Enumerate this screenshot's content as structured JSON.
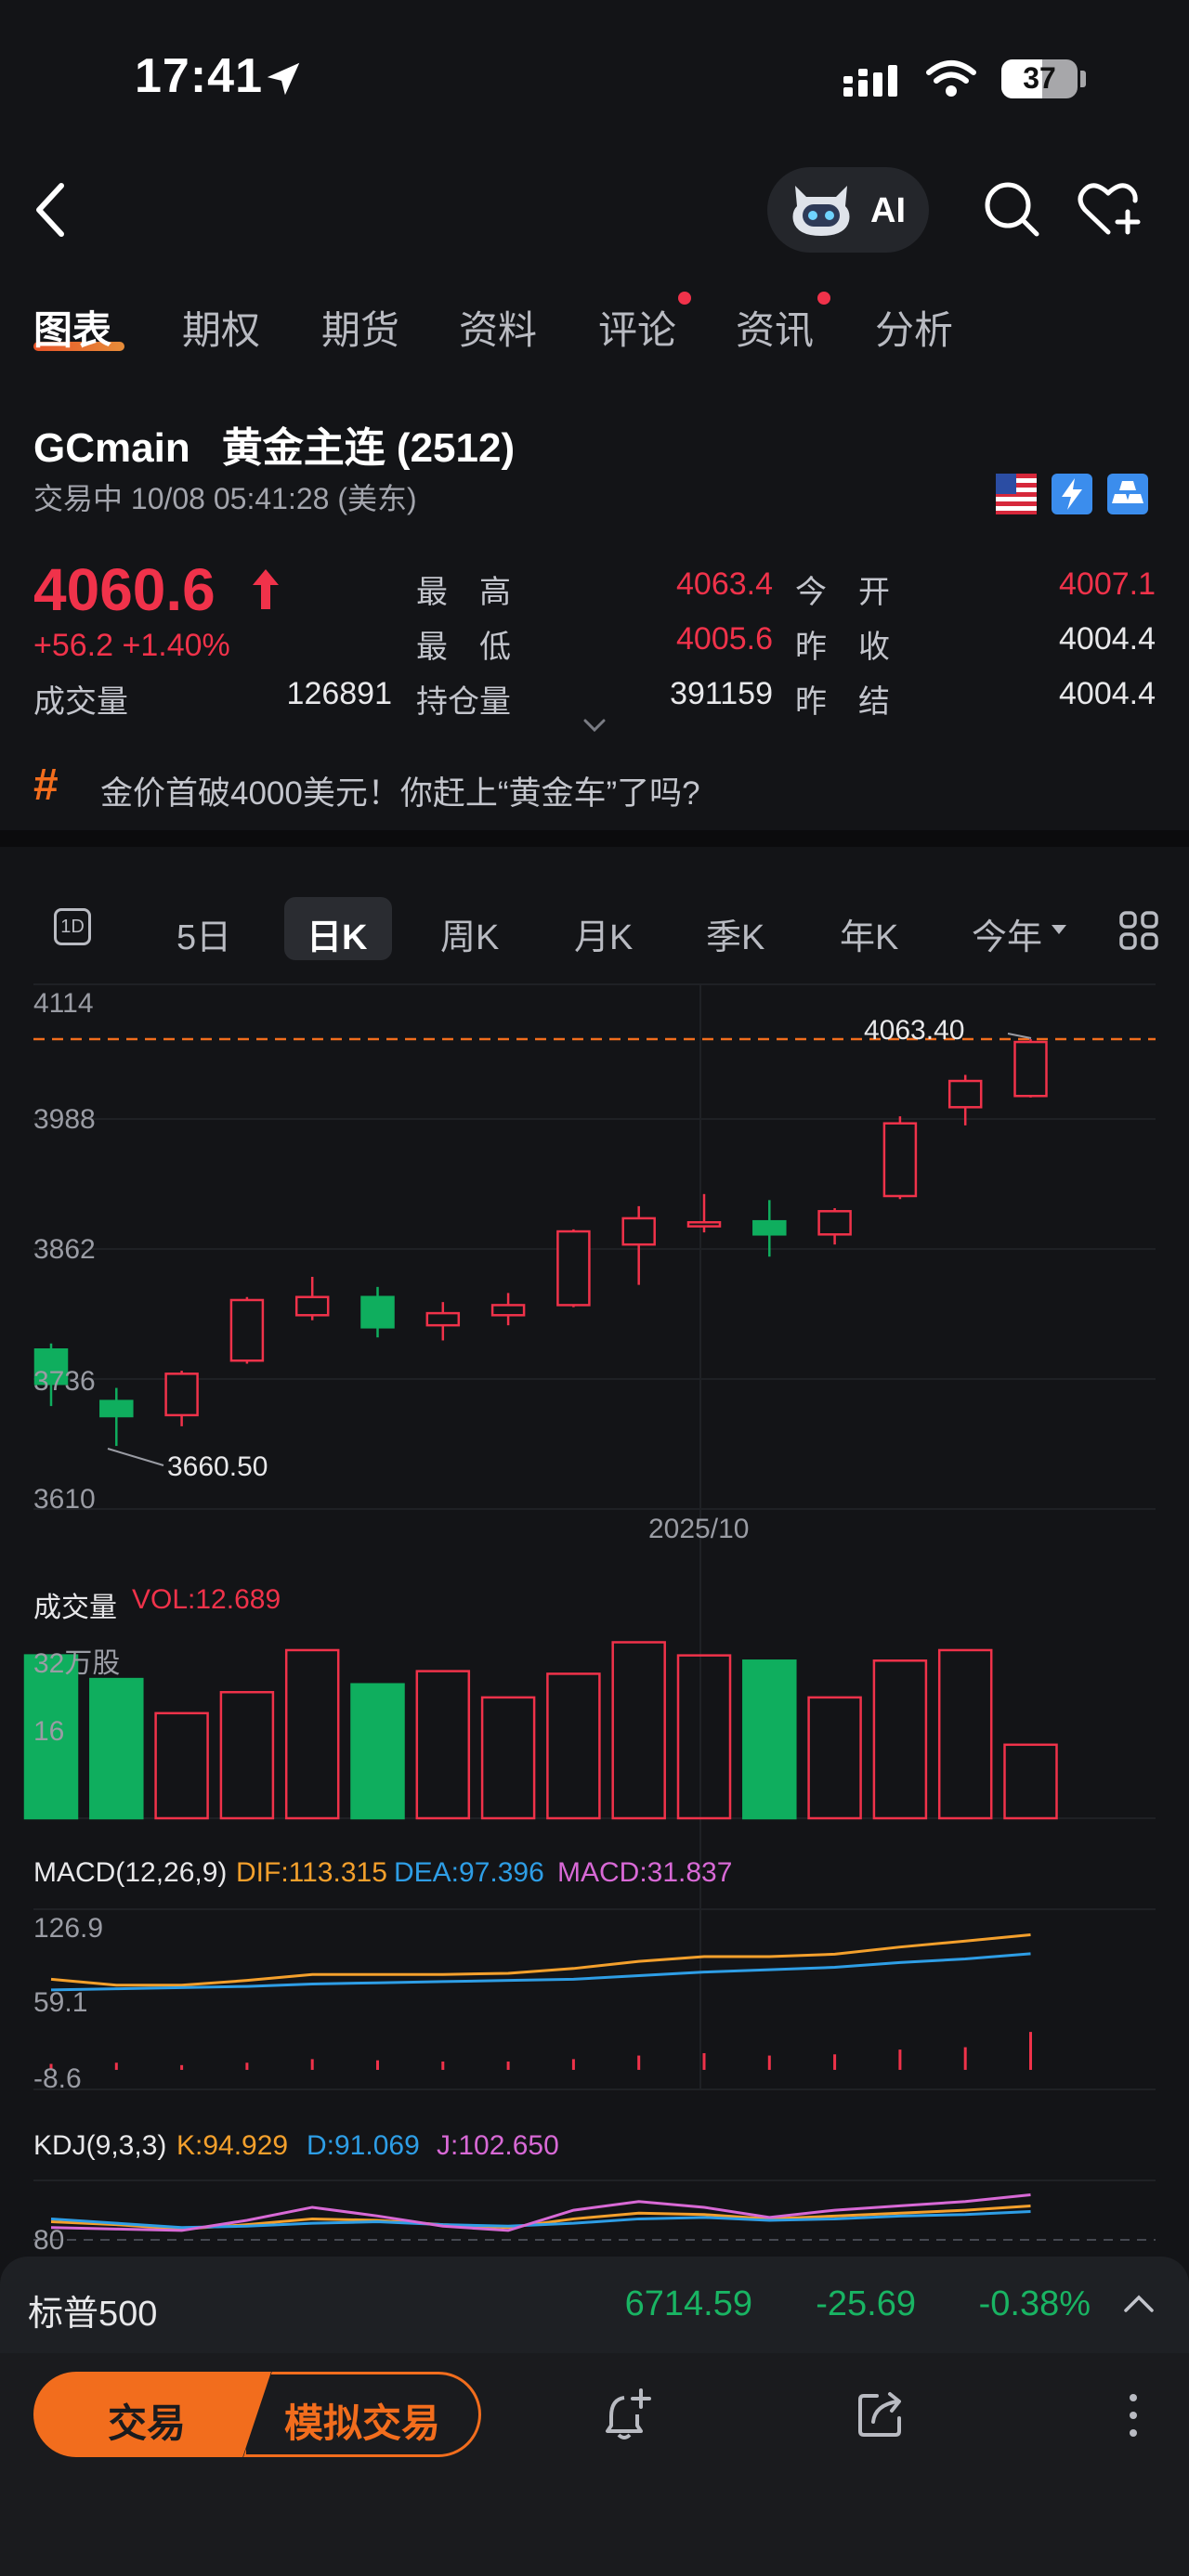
{
  "status": {
    "time": "17:41",
    "battery": "37"
  },
  "nav": {
    "ai_label": "AI"
  },
  "tabs": [
    {
      "label": "图表"
    },
    {
      "label": "期权"
    },
    {
      "label": "期货"
    },
    {
      "label": "资料"
    },
    {
      "label": "评论"
    },
    {
      "label": "资讯"
    },
    {
      "label": "分析"
    }
  ],
  "quote": {
    "symbol": "GCmain",
    "name": "黄金主连 (2512)",
    "status_line": "交易中 10/08 05:41:28 (美东)",
    "price": "4060.6",
    "change": "+56.2",
    "change_pct": "+1.40%",
    "volume_label": "成交量",
    "volume": "126891",
    "high_label": "最　高",
    "high": "4063.4",
    "low_label": "最　低",
    "low": "4005.6",
    "oi_label": "持仓量",
    "open_interest": "391159",
    "open_label": "今　开",
    "open": "4007.1",
    "prev_close_label": "昨　收",
    "prev_close": "4004.4",
    "prev_settle_label": "昨　结",
    "prev_settle": "4004.4"
  },
  "news": {
    "tag": "#",
    "headline": "金价首破4000美元！你赶上“黄金车”了吗?"
  },
  "periods": [
    {
      "label": "1D"
    },
    {
      "label": "5日"
    },
    {
      "label": "日K"
    },
    {
      "label": "周K"
    },
    {
      "label": "月K"
    },
    {
      "label": "季K"
    },
    {
      "label": "年K"
    },
    {
      "label": "今年"
    }
  ],
  "main_chart": {
    "y_ticks": [
      "4114",
      "3988",
      "3862",
      "3736",
      "3610"
    ],
    "max_label": "4063.40",
    "min_label": "3660.50",
    "date_label": "2025/10"
  },
  "volume_panel": {
    "title": "成交量",
    "vol_text": "VOL:12.689",
    "y_top": "32万股",
    "y_mid": "16"
  },
  "macd_panel": {
    "title": "MACD(12,26,9)",
    "dif": "DIF:113.315",
    "dea": "DEA:97.396",
    "macd": "MACD:31.837",
    "y_ticks": [
      "126.9",
      "59.1",
      "-8.6"
    ]
  },
  "kdj_panel": {
    "title": "KDJ(9,3,3)",
    "k": "K:94.929",
    "d": "D:91.069",
    "j": "J:102.650",
    "y_tick": "80"
  },
  "ticker": {
    "name": "标普500",
    "value": "6714.59",
    "change": "-25.69",
    "change_pct": "-0.38%"
  },
  "actions": {
    "trade": "交易",
    "sim_trade": "模拟交易"
  },
  "colors": {
    "up": "#f0324a",
    "down": "#0fae5e",
    "accent": "#f26d1d"
  },
  "chart_data": [
    {
      "type": "candlestick",
      "title": "",
      "ylim": [
        3610,
        4114
      ],
      "y_ticks": [
        4114,
        3988,
        3862,
        3736,
        3610
      ],
      "reference_line": 4063.4,
      "annotations": [
        {
          "text": "4063.40"
        },
        {
          "text": "3660.50"
        },
        {
          "text": "2025/10"
        }
      ],
      "candles": [
        {
          "open": 3756,
          "close": 3722,
          "high": 3762,
          "low": 3700
        },
        {
          "open": 3705,
          "close": 3690,
          "high": 3718,
          "low": 3660.5
        },
        {
          "open": 3691,
          "close": 3732,
          "high": 3735,
          "low": 3680
        },
        {
          "open": 3745,
          "close": 3805,
          "high": 3808,
          "low": 3742
        },
        {
          "open": 3790,
          "close": 3808,
          "high": 3828,
          "low": 3785
        },
        {
          "open": 3808,
          "close": 3778,
          "high": 3818,
          "low": 3768
        },
        {
          "open": 3780,
          "close": 3792,
          "high": 3803,
          "low": 3765
        },
        {
          "open": 3790,
          "close": 3800,
          "high": 3812,
          "low": 3780
        },
        {
          "open": 3800,
          "close": 3873,
          "high": 3875,
          "low": 3798
        },
        {
          "open": 3860,
          "close": 3886,
          "high": 3898,
          "low": 3820
        },
        {
          "open": 3878,
          "close": 3882,
          "high": 3910,
          "low": 3872
        },
        {
          "open": 3883,
          "close": 3870,
          "high": 3904,
          "low": 3848
        },
        {
          "open": 3870,
          "close": 3893,
          "high": 3896,
          "low": 3860
        },
        {
          "open": 3908,
          "close": 3980,
          "high": 3987,
          "low": 3905
        },
        {
          "open": 3996,
          "close": 4022,
          "high": 4028,
          "low": 3978
        },
        {
          "open": 4007.1,
          "close": 4060.6,
          "high": 4063.4,
          "low": 4005.6
        }
      ]
    },
    {
      "type": "bar",
      "title": "成交量",
      "ylim": [
        0,
        35
      ],
      "values": [
        31,
        26.5,
        20,
        24,
        32,
        25.5,
        28,
        23,
        27.5,
        33.5,
        31,
        30,
        23,
        30,
        32,
        14
      ],
      "directions": [
        "down",
        "down",
        "up",
        "up",
        "up",
        "down",
        "up",
        "up",
        "up",
        "up",
        "up",
        "down",
        "up",
        "up",
        "up",
        "up"
      ]
    },
    {
      "type": "line",
      "title": "MACD(12,26,9)",
      "ylim": [
        -8.6,
        126.9
      ],
      "series": [
        {
          "name": "DIF",
          "values": [
            76,
            71,
            71,
            75,
            80,
            80,
            80,
            81,
            85,
            91,
            95,
            95,
            97,
            103,
            108,
            113.3
          ]
        },
        {
          "name": "DEA",
          "values": [
            67,
            68,
            69,
            70,
            72,
            73,
            74,
            75,
            76,
            79,
            82,
            84,
            86,
            90,
            93,
            97.4
          ]
        }
      ],
      "histogram": [
        5,
        6,
        4,
        6,
        9,
        8,
        7,
        7,
        9,
        12,
        14,
        12,
        13,
        17,
        19,
        31.8
      ]
    },
    {
      "type": "line",
      "title": "KDJ(9,3,3)",
      "y_tick": 80,
      "series": [
        {
          "name": "K",
          "values": [
            84,
            82,
            79,
            82,
            86,
            85,
            82,
            80,
            86,
            90,
            89,
            86,
            88,
            90,
            92,
            94.9
          ]
        },
        {
          "name": "D",
          "values": [
            86,
            83,
            80,
            81,
            83,
            84,
            82,
            81,
            83,
            86,
            87,
            85,
            86,
            88,
            89,
            91.1
          ]
        },
        {
          "name": "J",
          "values": [
            80,
            79,
            78,
            85,
            94,
            88,
            81,
            78,
            92,
            98,
            94,
            87,
            92,
            95,
            98,
            102.65
          ]
        }
      ]
    }
  ]
}
